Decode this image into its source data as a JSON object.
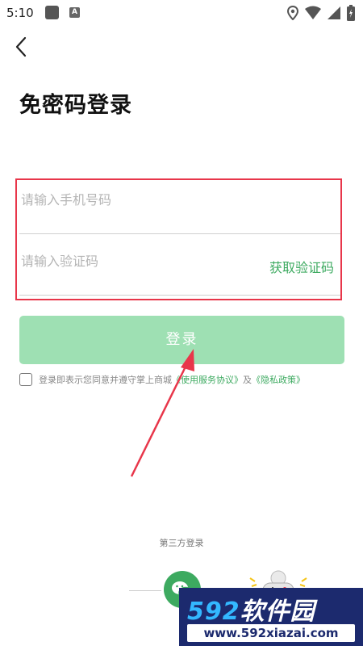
{
  "status_bar": {
    "time": "5:10"
  },
  "page": {
    "title": "免密码登录"
  },
  "form": {
    "phone_placeholder": "请输入手机号码",
    "code_placeholder": "请输入验证码",
    "get_code_label": "获取验证码",
    "login_label": "登录"
  },
  "agreement": {
    "text_before": "登录即表示您同意并遵守掌上商城",
    "terms_link": "《使用服务协议》",
    "joiner": "及",
    "privacy_link": "《隐私政策》"
  },
  "third_party": {
    "label": "第三方登录"
  },
  "watermark": {
    "brand_num": "592",
    "brand_text": "软件园",
    "url": "www.592xiazai.com"
  },
  "colors": {
    "accent_green": "#3daa60",
    "button_disabled": "#9ee0b3",
    "highlight_red": "#e8364a"
  },
  "icons": [
    "back-arrow-icon",
    "wechat-icon",
    "game-controller-icon",
    "location-icon",
    "wifi-icon",
    "signal-icon",
    "battery-icon"
  ]
}
